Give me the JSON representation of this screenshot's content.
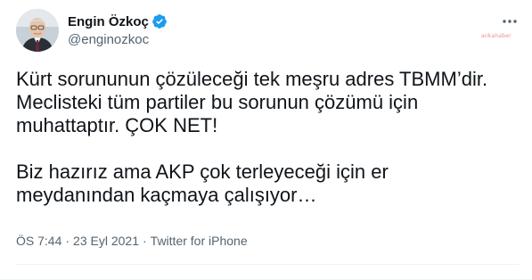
{
  "author": {
    "display_name": "Engin Özkoç",
    "handle": "@enginozkoc",
    "verified": true,
    "verified_color": "#1d9bf0"
  },
  "watermark": "ankahaber",
  "tweet": {
    "paragraph1": [
      "Kürt sorununun çözüleceği tek meşru adres TBMM’dir.",
      "Meclisteki tüm partiler bu sorunun çözümü için",
      "muhattaptır. ÇOK NET!"
    ],
    "paragraph2": [
      "Biz hazırız ama AKP çok terleyeceği için er",
      "meydanından kaçmaya çalışıyor…"
    ]
  },
  "meta": {
    "time": "ÖS 7:44",
    "separator": "·",
    "date": "23 Eyl 2021",
    "source": "Twitter for iPhone"
  },
  "icons": {
    "more": "more-horizontal-icon",
    "verified": "verified-badge-icon"
  }
}
